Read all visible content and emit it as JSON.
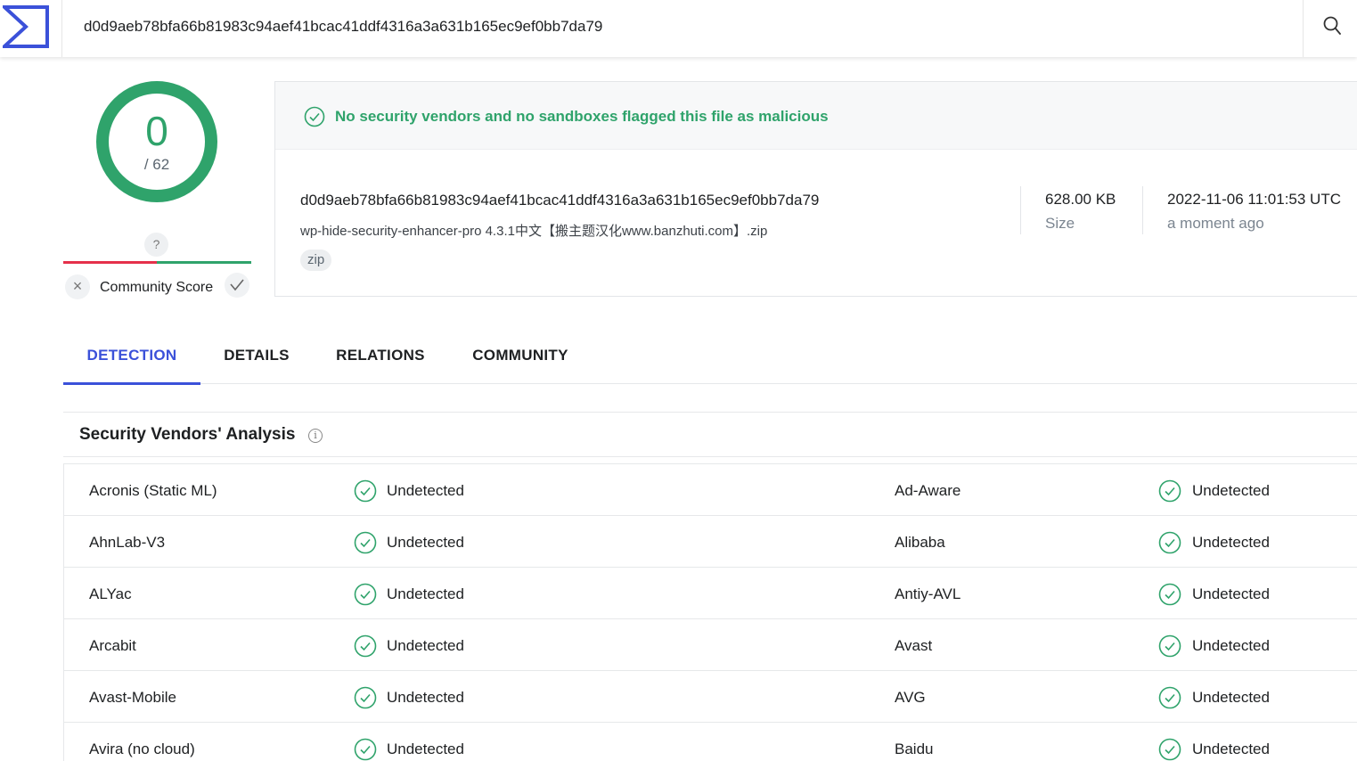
{
  "search": {
    "value": "d0d9aeb78bfa66b81983c94aef41bcac41ddf4316a3a631b165ec9ef0bb7da79",
    "logo_icon": "virustotal-sigma-logo",
    "button_icon": "search-icon"
  },
  "score": {
    "detections": "0",
    "total": "/ 62",
    "ring_fraction": 1.0,
    "ring_color": "#2fa36b"
  },
  "community": {
    "unknown_badge": "?",
    "label": "Community Score",
    "negative_icon": "x-icon",
    "positive_icon": "check-icon",
    "negative_color": "#e5304a",
    "positive_color": "#2fa36b"
  },
  "summary": {
    "status_message": "No security vendors and no sandboxes flagged this file as malicious",
    "hash": "d0d9aeb78bfa66b81983c94aef41bcac41ddf4316a3a631b165ec9ef0bb7da79",
    "file_name": "wp-hide-security-enhancer-pro 4.3.1中文【搬主题汉化www.banzhuti.com】.zip",
    "tag": "zip",
    "size_value": "628.00 KB",
    "size_label": "Size",
    "date_value": "2022-11-06 11:01:53 UTC",
    "date_relative": "a moment ago"
  },
  "tabs": [
    {
      "label": "DETECTION",
      "active": true
    },
    {
      "label": "DETAILS",
      "active": false
    },
    {
      "label": "RELATIONS",
      "active": false
    },
    {
      "label": "COMMUNITY",
      "active": false
    }
  ],
  "vendors": {
    "title": "Security Vendors' Analysis",
    "info_icon": "info-icon",
    "result_icon": "check-circle-icon",
    "rows": [
      {
        "left_name": "Acronis (Static ML)",
        "left_result": "Undetected",
        "right_name": "Ad-Aware",
        "right_result": "Undetected"
      },
      {
        "left_name": "AhnLab-V3",
        "left_result": "Undetected",
        "right_name": "Alibaba",
        "right_result": "Undetected"
      },
      {
        "left_name": "ALYac",
        "left_result": "Undetected",
        "right_name": "Antiy-AVL",
        "right_result": "Undetected"
      },
      {
        "left_name": "Arcabit",
        "left_result": "Undetected",
        "right_name": "Avast",
        "right_result": "Undetected"
      },
      {
        "left_name": "Avast-Mobile",
        "left_result": "Undetected",
        "right_name": "AVG",
        "right_result": "Undetected"
      },
      {
        "left_name": "Avira (no cloud)",
        "left_result": "Undetected",
        "right_name": "Baidu",
        "right_result": "Undetected"
      }
    ]
  }
}
